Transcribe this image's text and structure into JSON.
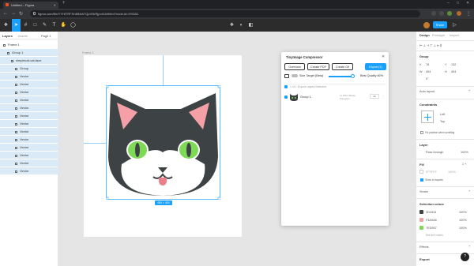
{
  "browser": {
    "tab_title": "Untitled – Figma",
    "new_tab": "+",
    "url": "figma.com/file/YYHf7RFSnMNsh7QpVNrRjpor/Untitled?node-id=0%3A1",
    "window_controls": [
      "–",
      "□",
      "✕"
    ]
  },
  "toolbar": {
    "doc_title": "",
    "share_label": "Share",
    "zoom": "",
    "accent": "#18a0fb"
  },
  "layers_panel": {
    "tabs": [
      "Layers",
      "Assets",
      "Page 1"
    ],
    "items": [
      {
        "label": "Frame 1",
        "indent": 0,
        "selected": false
      },
      {
        "label": "Group 1",
        "indent": 1,
        "selected": true
      },
      {
        "label": "simplecat-cat-face",
        "indent": 2,
        "selected": true
      },
      {
        "label": "Group",
        "indent": 3,
        "selected": true
      },
      {
        "label": "Vector",
        "indent": 3,
        "selected": true
      },
      {
        "label": "Vector",
        "indent": 3,
        "selected": true
      },
      {
        "label": "Vector",
        "indent": 3,
        "selected": true
      },
      {
        "label": "Vector",
        "indent": 3,
        "selected": true
      },
      {
        "label": "Vector",
        "indent": 3,
        "selected": true
      },
      {
        "label": "Vector",
        "indent": 3,
        "selected": true
      },
      {
        "label": "Vector",
        "indent": 3,
        "selected": true
      },
      {
        "label": "Vector",
        "indent": 3,
        "selected": true
      },
      {
        "label": "Vector",
        "indent": 3,
        "selected": true
      },
      {
        "label": "Vector",
        "indent": 3,
        "selected": true
      },
      {
        "label": "Vector",
        "indent": 3,
        "selected": true
      },
      {
        "label": "Vector",
        "indent": 3,
        "selected": true
      },
      {
        "label": "Vector",
        "indent": 3,
        "selected": true
      }
    ]
  },
  "canvas": {
    "frame_label": "Frame 1",
    "size_badge": "454 × 454",
    "cat_colors": {
      "head": "#3d4344",
      "face": "#ffffff",
      "ears_inner": "#f4a0a6",
      "eyes": "#7ed957",
      "tongue": "#e8818c"
    }
  },
  "plugin": {
    "title": "TinyImage Compressor",
    "close": "✕",
    "buttons": [
      "Overview",
      "Create PDF",
      "Create Gif"
    ],
    "export_label": "Export (1)",
    "size_target_label": "Size Target (Beta)",
    "quality_label": "Best Quality 80%",
    "select_all_label": "1 of 1 Export Layers Selected",
    "item": {
      "name": "Group 1",
      "format_line1": "1x PNG (Beta)",
      "format_line2": "6 Exports",
      "scale": "1x"
    }
  },
  "design_panel": {
    "tabs": [
      "Design",
      "Prototype",
      "Inspect"
    ],
    "group_label": "Group",
    "x": "78",
    "y": "132",
    "w": "454",
    "h": "454",
    "rotation": "0°",
    "auto_layout": "Auto layout",
    "constraints_title": "Constraints",
    "constraint_h": "Left",
    "constraint_v": "Top",
    "fix_position": "Fix position when scrolling",
    "layer_title": "Layer",
    "blend": "Pass through",
    "opacity": "100%",
    "fill_title": "Fill",
    "fill_hex": "FFFFFF",
    "fill_pct": "100%",
    "show_exports": "Show in exports",
    "stroke_title": "Stroke",
    "selection_colors_title": "Selection colors",
    "colors": [
      {
        "hex": "#3D4344",
        "label": "3D4344",
        "pct": "100%"
      },
      {
        "hex": "#F4A0A6",
        "label": "F4A0A6",
        "pct": "100%"
      },
      {
        "hex": "#7ED957",
        "label": "7ED957",
        "pct": "100%"
      }
    ],
    "see_all": "See all 6 colors",
    "effects_title": "Effects",
    "export_title": "Export"
  }
}
